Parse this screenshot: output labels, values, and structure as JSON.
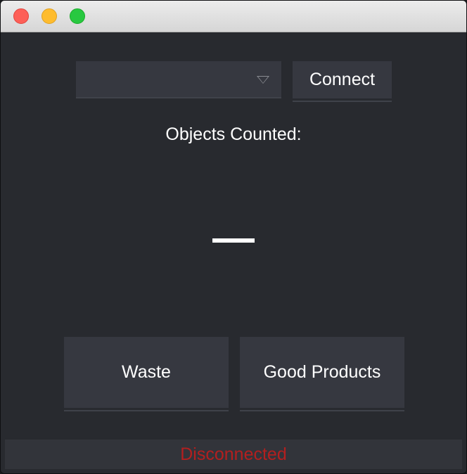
{
  "window": {
    "controls": [
      "close",
      "minimize",
      "zoom"
    ]
  },
  "connection": {
    "port_select_value": "",
    "connect_label": "Connect"
  },
  "counter": {
    "label": "Objects Counted:",
    "value": "—"
  },
  "actions": {
    "waste_label": "Waste",
    "good_label": "Good Products"
  },
  "status": {
    "text": "Disconnected",
    "color": "#b31f1f"
  },
  "colors": {
    "background": "#282a2f",
    "button": "#363840",
    "text": "#ffffff"
  },
  "icons": {
    "dropdown": "chevron-down-icon"
  }
}
